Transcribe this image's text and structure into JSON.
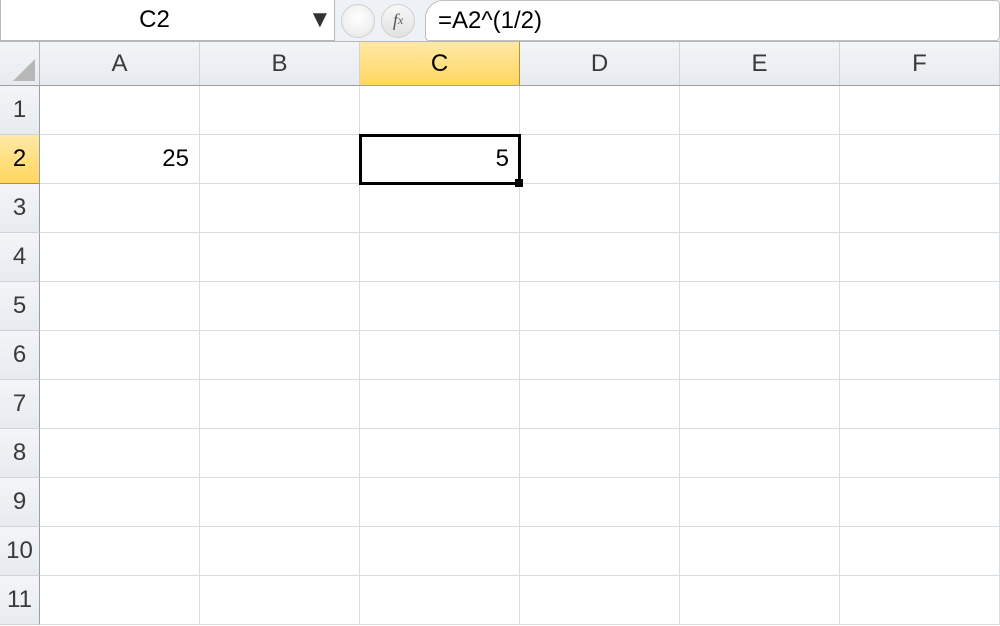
{
  "formula_bar": {
    "name_box": "C2",
    "dropdown_glyph": "▼",
    "fx_label": "f",
    "fx_sub": "x",
    "formula": "=A2^(1/2)"
  },
  "columns": [
    "A",
    "B",
    "C",
    "D",
    "E",
    "F"
  ],
  "rows": [
    "1",
    "2",
    "3",
    "4",
    "5",
    "6",
    "7",
    "8",
    "9",
    "10",
    "11"
  ],
  "active_column": "C",
  "active_row": "2",
  "cells": {
    "A2": "25",
    "C2": "5"
  }
}
